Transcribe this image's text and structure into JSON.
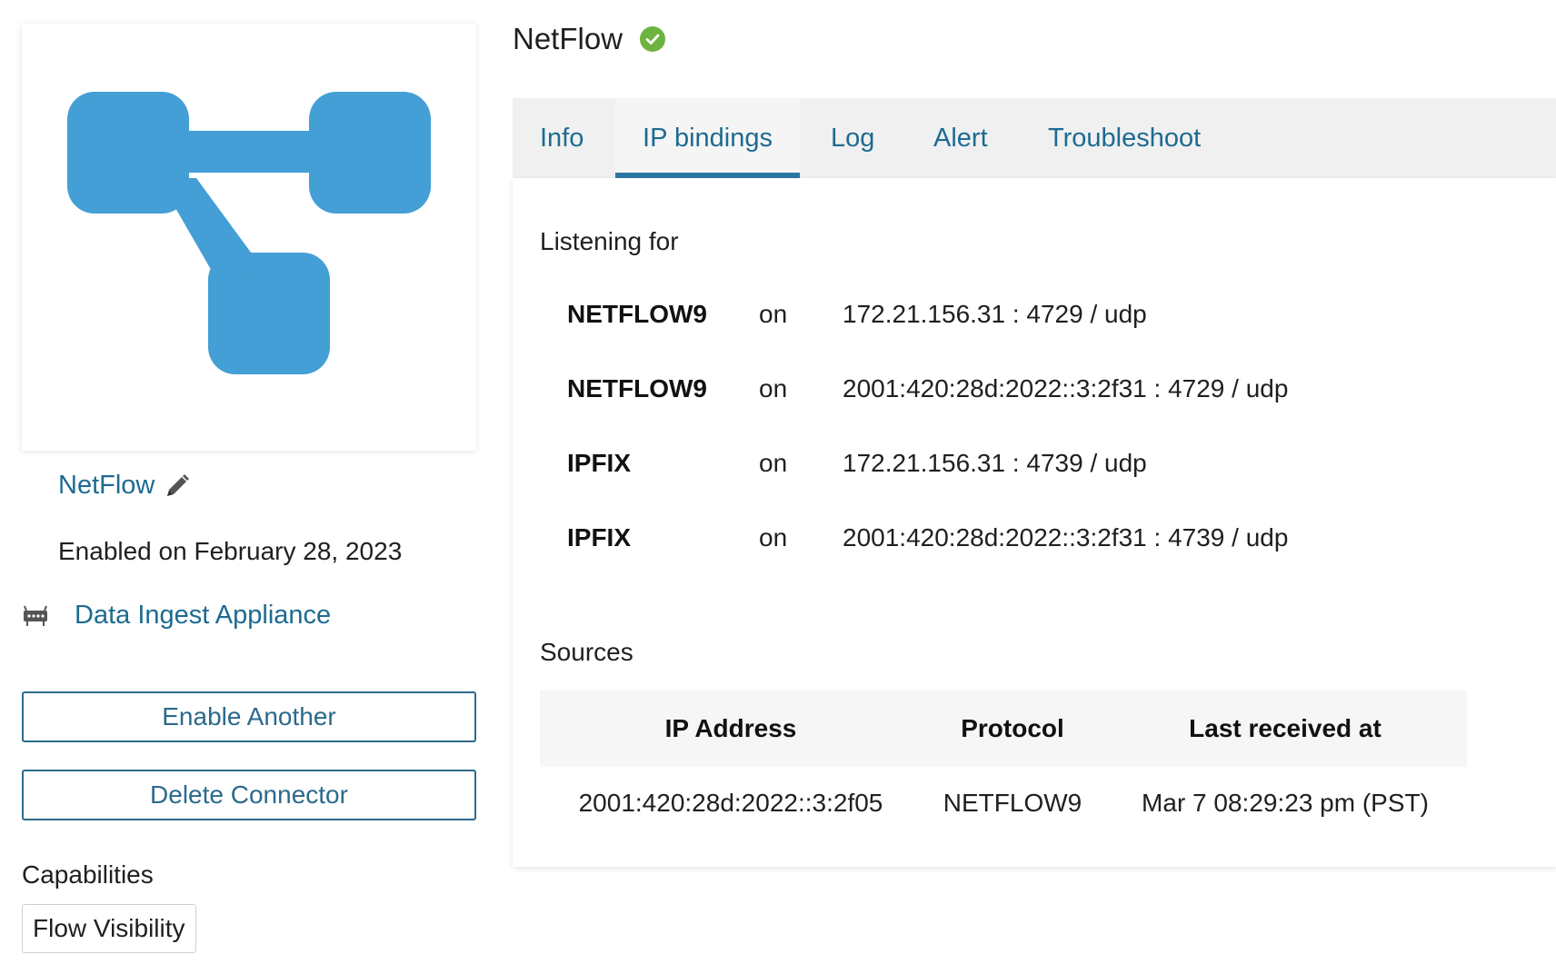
{
  "connector": {
    "name": "NetFlow",
    "enabled_on": "Enabled on February 28, 2023",
    "appliance": "Data Ingest Appliance",
    "logo_color": "#439fd5"
  },
  "actions": {
    "enable_another": "Enable Another",
    "delete_connector": "Delete Connector"
  },
  "capabilities": {
    "title": "Capabilities",
    "items": [
      "Flow Visibility"
    ]
  },
  "header": {
    "title": "NetFlow",
    "status_color": "#6db33f"
  },
  "tabs": [
    {
      "label": "Info",
      "active": false
    },
    {
      "label": "IP bindings",
      "active": true
    },
    {
      "label": "Log",
      "active": false
    },
    {
      "label": "Alert",
      "active": false
    },
    {
      "label": "Troubleshoot",
      "active": false
    }
  ],
  "listening": {
    "title": "Listening for",
    "rows": [
      {
        "protocol": "NETFLOW9",
        "on": "on",
        "address": "172.21.156.31 : 4729 / udp"
      },
      {
        "protocol": "NETFLOW9",
        "on": "on",
        "address": "2001:420:28d:2022::3:2f31 : 4729 / udp"
      },
      {
        "protocol": "IPFIX",
        "on": "on",
        "address": "172.21.156.31 : 4739 / udp"
      },
      {
        "protocol": "IPFIX",
        "on": "on",
        "address": "2001:420:28d:2022::3:2f31 : 4739 / udp"
      }
    ]
  },
  "sources": {
    "title": "Sources",
    "columns": [
      "IP Address",
      "Protocol",
      "Last received at"
    ],
    "rows": [
      {
        "ip": "2001:420:28d:2022::3:2f05",
        "protocol": "NETFLOW9",
        "last": "Mar 7 08:29:23 pm (PST)"
      }
    ]
  }
}
